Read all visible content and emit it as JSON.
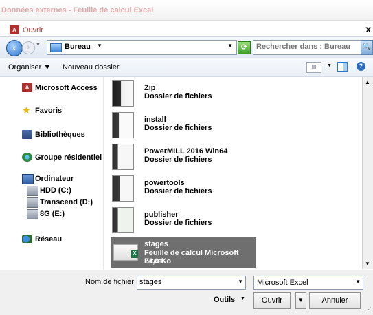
{
  "window": {
    "outer_title": "Données externes - Feuille de calcul Excel"
  },
  "dialog": {
    "title": "Ouvrir",
    "app_icon": "A",
    "close": "x"
  },
  "address": {
    "location": "Bureau",
    "search_placeholder": "Rechercher dans : Bureau"
  },
  "toolbar": {
    "organize": "Organiser ▼",
    "new_folder": "Nouveau dossier"
  },
  "nav": {
    "items": [
      {
        "label": "Microsoft Access",
        "icon": "access-icon"
      },
      {
        "label": "Favoris",
        "icon": "star-icon"
      },
      {
        "label": "Bibliothèques",
        "icon": "library-icon"
      },
      {
        "label": "Groupe résidentiel",
        "icon": "homegroup-icon"
      },
      {
        "label": "Ordinateur",
        "icon": "computer-icon"
      },
      {
        "label": "HDD (C:)",
        "icon": "drive-icon"
      },
      {
        "label": "Transcend (D:)",
        "icon": "drive-icon"
      },
      {
        "label": "8G (E:)",
        "icon": "drive-icon"
      },
      {
        "label": "Réseau",
        "icon": "network-icon"
      }
    ]
  },
  "files": [
    {
      "name": "Zip",
      "type": "Dossier de fichiers"
    },
    {
      "name": "install",
      "type": "Dossier de fichiers"
    },
    {
      "name": "PowerMILL 2016 Win64",
      "type": "Dossier de fichiers"
    },
    {
      "name": "powertools",
      "type": "Dossier de fichiers"
    },
    {
      "name": "publisher",
      "type": "Dossier de fichiers"
    },
    {
      "name": "stages",
      "type": "Feuille de calcul Microsoft Excel",
      "size": "24,0 Ko",
      "selected": true
    }
  ],
  "bottom": {
    "filename_label": "Nom de fichier :",
    "filename_value": "stages",
    "filetype": "Microsoft Excel",
    "tools": "Outils",
    "open": "Ouvrir",
    "cancel": "Annuler"
  },
  "colors": {
    "selection": "#6f6f6f",
    "title_text": "#c04040"
  }
}
